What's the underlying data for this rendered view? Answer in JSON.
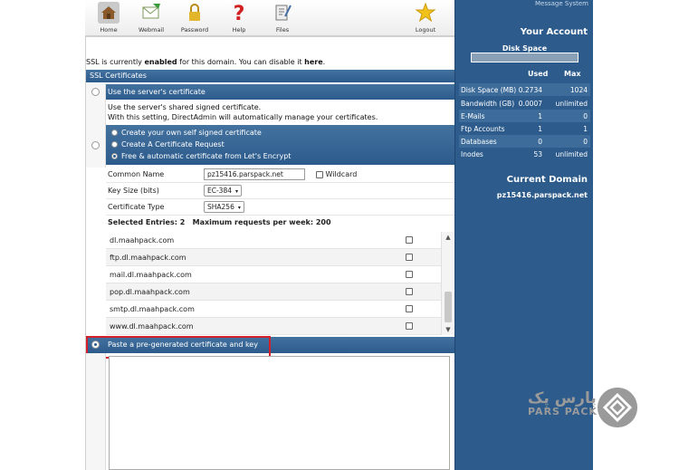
{
  "toolbar": {
    "items": [
      {
        "label": "Home",
        "icon": "home-icon"
      },
      {
        "label": "Webmail",
        "icon": "webmail-icon"
      },
      {
        "label": "Password",
        "icon": "lock-icon"
      },
      {
        "label": "Help",
        "icon": "help-icon"
      },
      {
        "label": "Files",
        "icon": "files-icon"
      },
      {
        "label": "Logout",
        "icon": "star-icon"
      }
    ]
  },
  "ssl_status": {
    "prefix": "SSL is currently ",
    "state": "enabled",
    "middle": " for this domain. You can disable it ",
    "link": "here",
    "suffix": "."
  },
  "section_title": "SSL Certificates",
  "option_server": "Use the server's certificate",
  "server_note_1": "Use the server's shared signed certificate.",
  "server_note_2": "With this setting, DirectAdmin will automatically manage your certificates.",
  "sub_options": [
    "Create your own self signed certificate",
    "Create A Certificate Request",
    "Free & automatic certificate from Let's Encrypt"
  ],
  "form": {
    "common_name_label": "Common Name",
    "common_name_value": "pz15416.parspack.net",
    "wildcard_label": "Wildcard",
    "key_size_label": "Key Size (bits)",
    "key_size_value": "EC-384",
    "cert_type_label": "Certificate Type",
    "cert_type_value": "SHA256"
  },
  "entries": {
    "selected": "Selected Entries: 2",
    "max": "Maximum requests per week: 200"
  },
  "domains": [
    "dl.maahpack.com",
    "ftp.dl.maahpack.com",
    "mail.dl.maahpack.com",
    "pop.dl.maahpack.com",
    "smtp.dl.maahpack.com",
    "www.dl.maahpack.com"
  ],
  "option_paste": "Paste a pre-generated certificate and key",
  "right_panel": {
    "top_text": "Message System",
    "account_title": "Your Account",
    "disk_space": "Disk Space",
    "col_used": "Used",
    "col_max": "Max",
    "stats": [
      {
        "label": "Disk Space (MB)",
        "used": "0.2734",
        "max": "1024"
      },
      {
        "label": "Bandwidth (GB)",
        "used": "0.0007",
        "max": "unlimited"
      },
      {
        "label": "E-Mails",
        "used": "1",
        "max": "0"
      },
      {
        "label": "Ftp Accounts",
        "used": "1",
        "max": "1"
      },
      {
        "label": "Databases",
        "used": "0",
        "max": "0"
      },
      {
        "label": "Inodes",
        "used": "53",
        "max": "unlimited"
      }
    ],
    "domain_title": "Current Domain",
    "domain": "pz15416.parspack.net"
  },
  "logo": {
    "fa": "پارس پک",
    "en": "PARS PACK"
  },
  "colors": {
    "panel": "#2c5b8c",
    "highlight": "#d4202a"
  }
}
